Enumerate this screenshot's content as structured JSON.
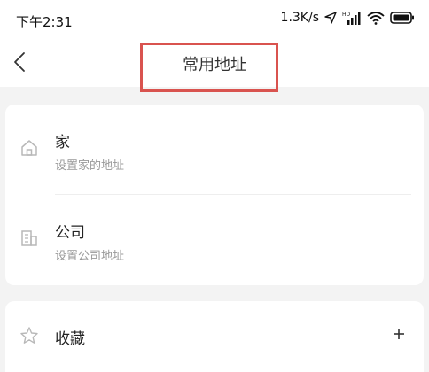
{
  "status_bar": {
    "time": "下午2:31",
    "network_speed": "1.3K/s",
    "icons": [
      "location-arrow-icon",
      "hd-signal-icon",
      "wifi-icon",
      "battery-icon"
    ]
  },
  "nav": {
    "title": "常用地址",
    "back_icon": "chevron-left-icon"
  },
  "addresses": {
    "items": [
      {
        "title": "家",
        "subtitle": "设置家的地址",
        "icon": "home-icon"
      },
      {
        "title": "公司",
        "subtitle": "设置公司地址",
        "icon": "building-icon"
      }
    ]
  },
  "favorites": {
    "title": "收藏",
    "icon": "star-icon",
    "add_icon": "plus-icon"
  },
  "colors": {
    "highlight": "#d9534f",
    "background": "#f3f3f3",
    "card": "#ffffff",
    "subtitle": "#999999",
    "icon": "#b8b8b8"
  }
}
